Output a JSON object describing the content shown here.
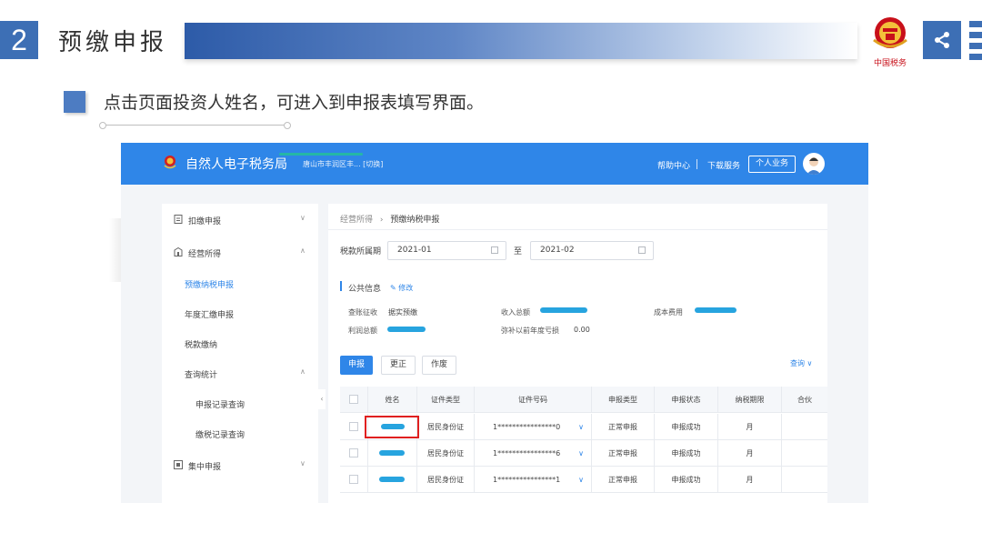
{
  "slide": {
    "number": "2",
    "title": "预缴申报",
    "instruction": "点击页面投资人姓名，可进入到申报表填写界面。",
    "emblem_caption": "中国税务"
  },
  "header": {
    "site_title": "自然人电子税务局",
    "location": "唐山市丰润区丰...  [切换]",
    "help": "帮助中心",
    "download": "下载服务",
    "personal": "个人业务"
  },
  "sidebar": {
    "items": [
      {
        "label": "扣缴申报",
        "icon": "form-icon"
      },
      {
        "label": "经营所得",
        "icon": "building-icon"
      },
      {
        "label": "预缴纳税申报",
        "active": true
      },
      {
        "label": "年度汇缴申报"
      },
      {
        "label": "税款缴纳"
      },
      {
        "label": "查询统计"
      },
      {
        "label": "申报记录查询"
      },
      {
        "label": "缴税记录查询"
      },
      {
        "label": "集中申报",
        "icon": "batch-icon"
      }
    ]
  },
  "main": {
    "breadcrumb_parent": "经营所得",
    "breadcrumb_sep": "›",
    "breadcrumb_current": "预缴纳税申报",
    "period_label": "税款所属期",
    "date_from": "2021-01",
    "date_to_sep": "至",
    "date_to": "2021-02",
    "section_title": "公共信息",
    "edit_link": "修改",
    "info": {
      "method_label": "查账征收",
      "method_value": "据实预缴",
      "income_label": "收入总额",
      "cost_label": "成本费用",
      "profit_label": "利润总额",
      "loss_label": "弥补以前年度亏损",
      "loss_value": "0.00"
    },
    "buttons": {
      "declare": "申报",
      "correct": "更正",
      "void": "作废"
    },
    "query": "查询 ∨",
    "table": {
      "headers": [
        "姓名",
        "证件类型",
        "证件号码",
        "申报类型",
        "申报状态",
        "纳税期限",
        "合伙"
      ],
      "rows": [
        {
          "id_type": "居民身份证",
          "id_no": "1****************0",
          "decl_type": "正常申报",
          "status": "申报成功",
          "period": "月"
        },
        {
          "id_type": "居民身份证",
          "id_no": "1****************6",
          "decl_type": "正常申报",
          "status": "申报成功",
          "period": "月"
        },
        {
          "id_type": "居民身份证",
          "id_no": "1****************1",
          "decl_type": "正常申报",
          "status": "申报成功",
          "period": "月"
        }
      ]
    }
  },
  "colors": {
    "brand": "#2f86e8",
    "slide_blue": "#3d6fb5",
    "highlight": "#e02020"
  }
}
